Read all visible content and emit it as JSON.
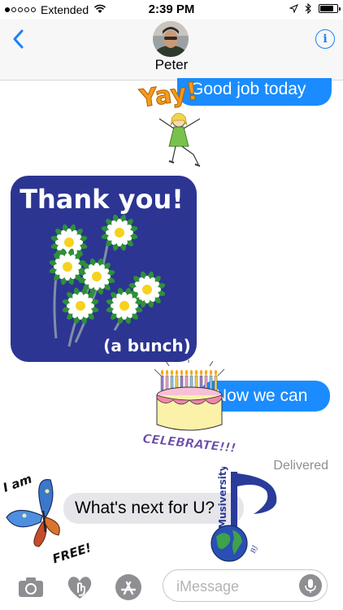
{
  "status_bar": {
    "carrier": "Extended",
    "time": "2:39 PM",
    "signal_bars": 1,
    "battery_level": 0.8
  },
  "header": {
    "contact_name": "Peter",
    "info_label": "i"
  },
  "messages": [
    {
      "type": "outgoing",
      "text": "Good job today"
    },
    {
      "type": "outgoing",
      "text": "Now we can"
    },
    {
      "type": "incoming",
      "text": "What's next for U?"
    }
  ],
  "stickers": {
    "yay": {
      "text": "Yay!"
    },
    "thank_you": {
      "title": "Thank you!",
      "caption": "(a bunch)"
    },
    "celebrate": {
      "text": "CELEBRATE!!!"
    },
    "butterfly": {
      "text_top": "I am",
      "text_bottom": "FREE!"
    },
    "musiversity": {
      "text": "Musiversity"
    }
  },
  "status": {
    "delivered_label": "Delivered"
  },
  "compose": {
    "placeholder": "iMessage"
  },
  "colors": {
    "accent": "#1a82fb",
    "bubble_out": "#1a8cff",
    "bubble_in": "#e6e5ea"
  },
  "icons": [
    "back-chevron-icon",
    "info-icon",
    "camera-icon",
    "digital-touch-icon",
    "app-store-icon",
    "microphone-icon"
  ]
}
